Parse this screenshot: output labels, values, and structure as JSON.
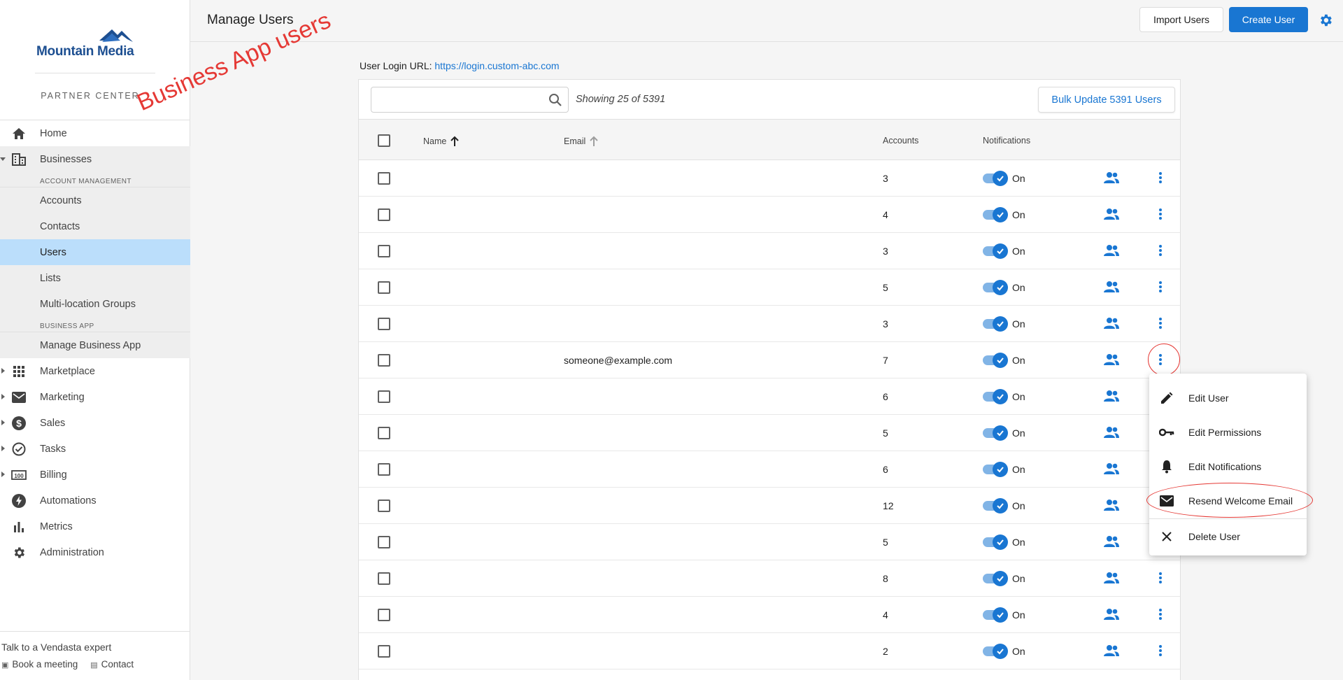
{
  "sidebar": {
    "brand": "Mountain Media",
    "subtitle": "PARTNER CENTER",
    "nav": {
      "home": "Home",
      "businesses": "Businesses",
      "account_management": "ACCOUNT MANAGEMENT",
      "accounts": "Accounts",
      "contacts": "Contacts",
      "users": "Users",
      "lists": "Lists",
      "multi_location": "Multi-location Groups",
      "business_app_section": "BUSINESS APP",
      "manage_business_app": "Manage Business App",
      "marketplace": "Marketplace",
      "marketing": "Marketing",
      "sales": "Sales",
      "tasks": "Tasks",
      "billing": "Billing",
      "automations": "Automations",
      "metrics": "Metrics",
      "administration": "Administration"
    },
    "footer": {
      "title": "Talk to a Vendasta expert",
      "book": "Book a meeting",
      "contact": "Contact"
    }
  },
  "annotation": {
    "text": "Business App users",
    "color": "#e53935"
  },
  "header": {
    "title": "Manage Users",
    "import_label": "Import Users",
    "create_label": "Create User"
  },
  "login": {
    "label": "User Login URL:",
    "url": "https://login.custom-abc.com"
  },
  "table": {
    "search_placeholder": "",
    "showing": "Showing 25 of 5391",
    "bulk_label": "Bulk Update 5391 Users",
    "headers": {
      "name": "Name",
      "email": "Email",
      "accounts": "Accounts",
      "notifications": "Notifications"
    },
    "rows": [
      {
        "email": "",
        "accounts": "3",
        "notif": "On"
      },
      {
        "email": "",
        "accounts": "4",
        "notif": "On"
      },
      {
        "email": "",
        "accounts": "3",
        "notif": "On"
      },
      {
        "email": "",
        "accounts": "5",
        "notif": "On"
      },
      {
        "email": "",
        "accounts": "3",
        "notif": "On"
      },
      {
        "email": "someone@example.com",
        "accounts": "7",
        "notif": "On"
      },
      {
        "email": "",
        "accounts": "6",
        "notif": "On"
      },
      {
        "email": "",
        "accounts": "5",
        "notif": "On"
      },
      {
        "email": "",
        "accounts": "6",
        "notif": "On"
      },
      {
        "email": "",
        "accounts": "12",
        "notif": "On"
      },
      {
        "email": "",
        "accounts": "5",
        "notif": "On"
      },
      {
        "email": "",
        "accounts": "8",
        "notif": "On"
      },
      {
        "email": "",
        "accounts": "4",
        "notif": "On"
      },
      {
        "email": "",
        "accounts": "2",
        "notif": "On"
      }
    ]
  },
  "menu": {
    "edit_user": "Edit User",
    "edit_permissions": "Edit Permissions",
    "edit_notifications": "Edit Notifications",
    "resend_welcome": "Resend Welcome Email",
    "delete_user": "Delete User"
  },
  "colors": {
    "accent": "#1976d2",
    "active_nav": "#bbdefb",
    "annotation": "#e53935"
  }
}
